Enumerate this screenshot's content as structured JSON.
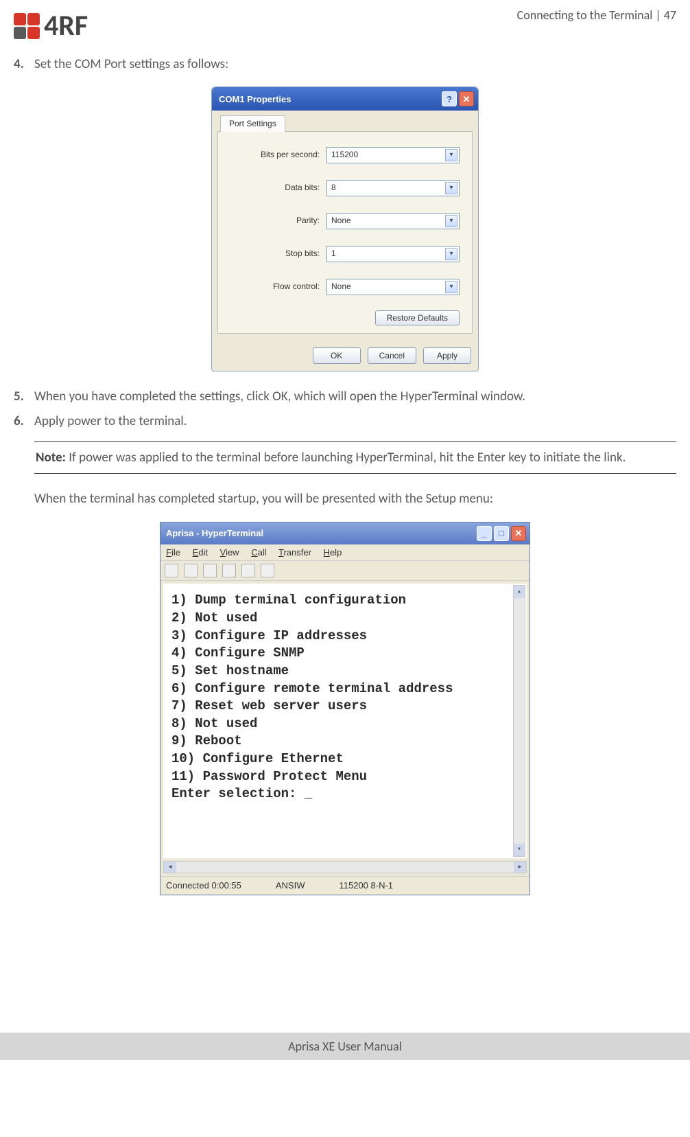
{
  "header": {
    "logo_text": "4RF",
    "breadcrumb": "Connecting to the Terminal  |  47"
  },
  "steps": {
    "s4": {
      "num": "4.",
      "text": "Set the COM Port settings as follows:"
    },
    "s5": {
      "num": "5.",
      "text": "When you have completed the settings, click OK, which will open the HyperTerminal window."
    },
    "s6": {
      "num": "6.",
      "text": "Apply power to the terminal."
    }
  },
  "dialog": {
    "title": "COM1 Properties",
    "tab": "Port Settings",
    "fields": {
      "bits_per_second": {
        "label": "Bits per second:",
        "value": "115200"
      },
      "data_bits": {
        "label": "Data bits:",
        "value": "8"
      },
      "parity": {
        "label": "Parity:",
        "value": "None"
      },
      "stop_bits": {
        "label": "Stop bits:",
        "value": "1"
      },
      "flow_control": {
        "label": "Flow control:",
        "value": "None"
      }
    },
    "buttons": {
      "restore": "Restore Defaults",
      "ok": "OK",
      "cancel": "Cancel",
      "apply": "Apply"
    }
  },
  "note": {
    "label": "Note:",
    "text": " If power was applied to the terminal before launching HyperTerminal, hit the Enter key to initiate the link."
  },
  "after_note": "When the terminal has completed startup, you will be presented with the Setup menu:",
  "hyperterminal": {
    "title": "Aprisa - HyperTerminal",
    "menu": {
      "file": "File",
      "edit": "Edit",
      "view": "View",
      "call": "Call",
      "transfer": "Transfer",
      "help": "Help"
    },
    "lines": [
      "1) Dump terminal configuration",
      "2) Not used",
      "3) Configure IP addresses",
      "4) Configure SNMP",
      "5) Set hostname",
      "6) Configure remote terminal address",
      "7) Reset web server users",
      "8) Not used",
      "9) Reboot",
      "10) Configure Ethernet",
      "11) Password Protect Menu",
      "Enter selection: _"
    ],
    "status": {
      "conn": "Connected 0:00:55",
      "emul": "ANSIW",
      "cfg": "115200 8-N-1"
    }
  },
  "footer": "Aprisa XE User Manual"
}
